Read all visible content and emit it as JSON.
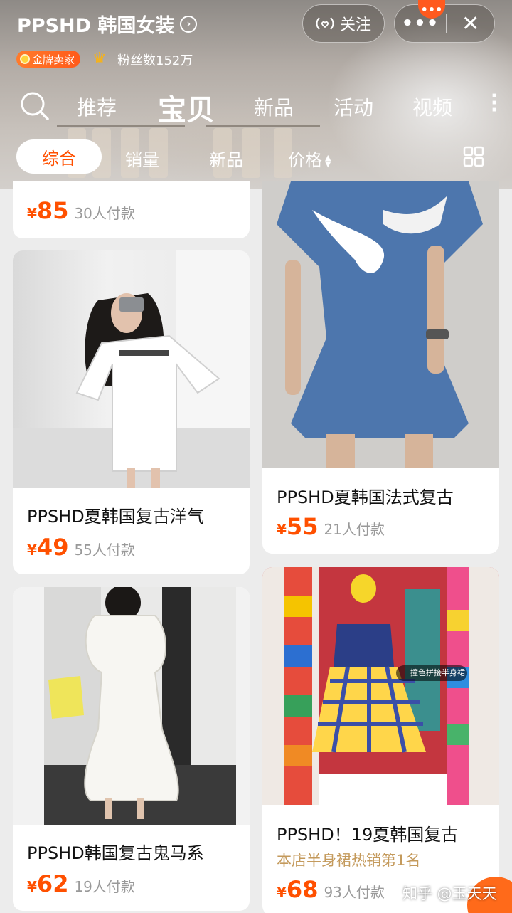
{
  "header": {
    "shop_name": "PPSHD 韩国女装",
    "follow_label": "关注",
    "more_label": "•••",
    "close_label": "✕",
    "seller_badge": "金牌卖家",
    "fans": "粉丝数152万"
  },
  "nav": {
    "tabs": [
      "推荐",
      "宝贝",
      "新品",
      "活动",
      "视频"
    ],
    "active_tab": "宝贝"
  },
  "filters": {
    "items": [
      "综合",
      "销量",
      "新品",
      "价格"
    ],
    "active": "综合"
  },
  "products": [
    {
      "title": "",
      "currency": "¥",
      "price": "85",
      "sold": "30人付款"
    },
    {
      "title": "PPSHD夏韩国复古洋气",
      "currency": "¥",
      "price": "49",
      "sold": "55人付款"
    },
    {
      "title": "PPSHD夏韩国法式复古",
      "currency": "¥",
      "price": "55",
      "sold": "21人付款"
    },
    {
      "title": "PPSHD韩国复古鬼马系",
      "currency": "¥",
      "price": "62",
      "sold": "19人付款"
    },
    {
      "title": "PPSHD！19夏韩国复古",
      "subtitle": "本店半身裙热销第1名",
      "currency": "¥",
      "price": "68",
      "sold": "93人付款"
    }
  ],
  "image_labels": {
    "skirt_tag": "撞色拼接半身裙"
  },
  "watermark": "知乎 @玉天天",
  "colors": {
    "accent": "#ff5000",
    "badge": "#ff5a1f",
    "subtitle": "#c49a5c"
  }
}
